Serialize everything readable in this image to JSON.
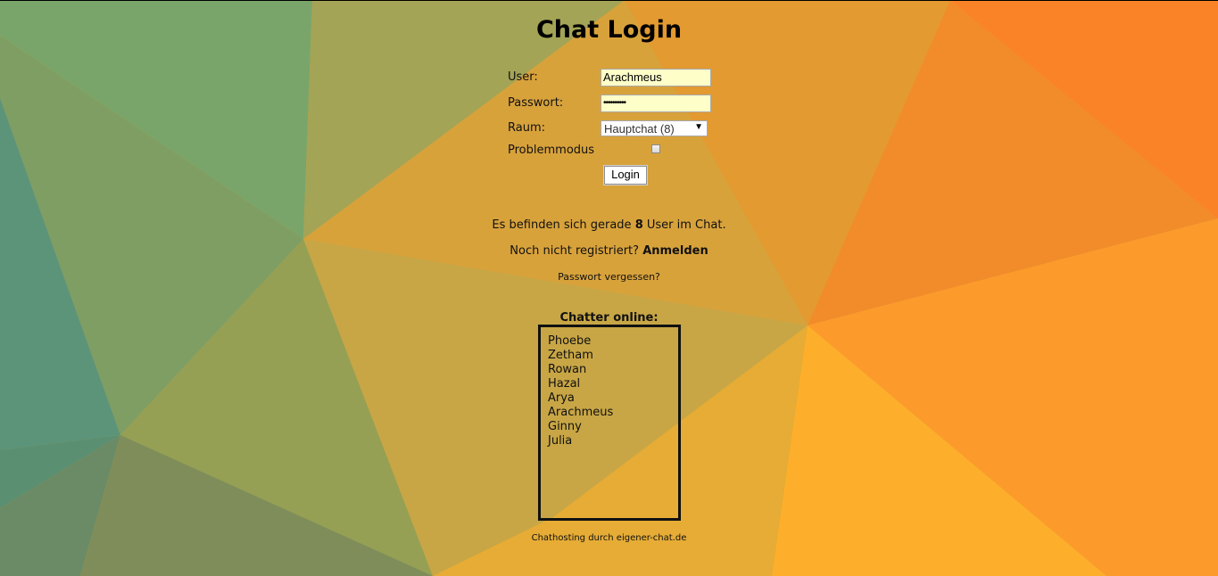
{
  "page": {
    "title": "Chat Login",
    "colors": {
      "left": "#5f9577",
      "center": "#d9a23a",
      "right": "#fb8a2a"
    }
  },
  "form": {
    "user_label": "User:",
    "user_value": "Arachmeus",
    "password_label": "Passwort:",
    "password_mask": "••••••••••",
    "room_label": "Raum:",
    "room_selected": "Hauptchat (8)",
    "problem_label": "Problemmodus",
    "problem_checked": false,
    "login_button": "Login"
  },
  "info": {
    "users_prefix": "Es befinden sich gerade",
    "users_count": "8",
    "users_suffix": "User im Chat.",
    "register_text": "Noch nicht registriert?",
    "register_link": "Anmelden",
    "forgot_link": "Passwort vergessen?"
  },
  "online": {
    "heading": "Chatter online:",
    "users": [
      "Phoebe",
      "Zetham",
      "Rowan",
      "Hazal",
      "Arya",
      "Arachmeus",
      "Ginny",
      "Julia"
    ]
  },
  "footer": {
    "text": "Chathosting durch eigener-chat.de"
  }
}
